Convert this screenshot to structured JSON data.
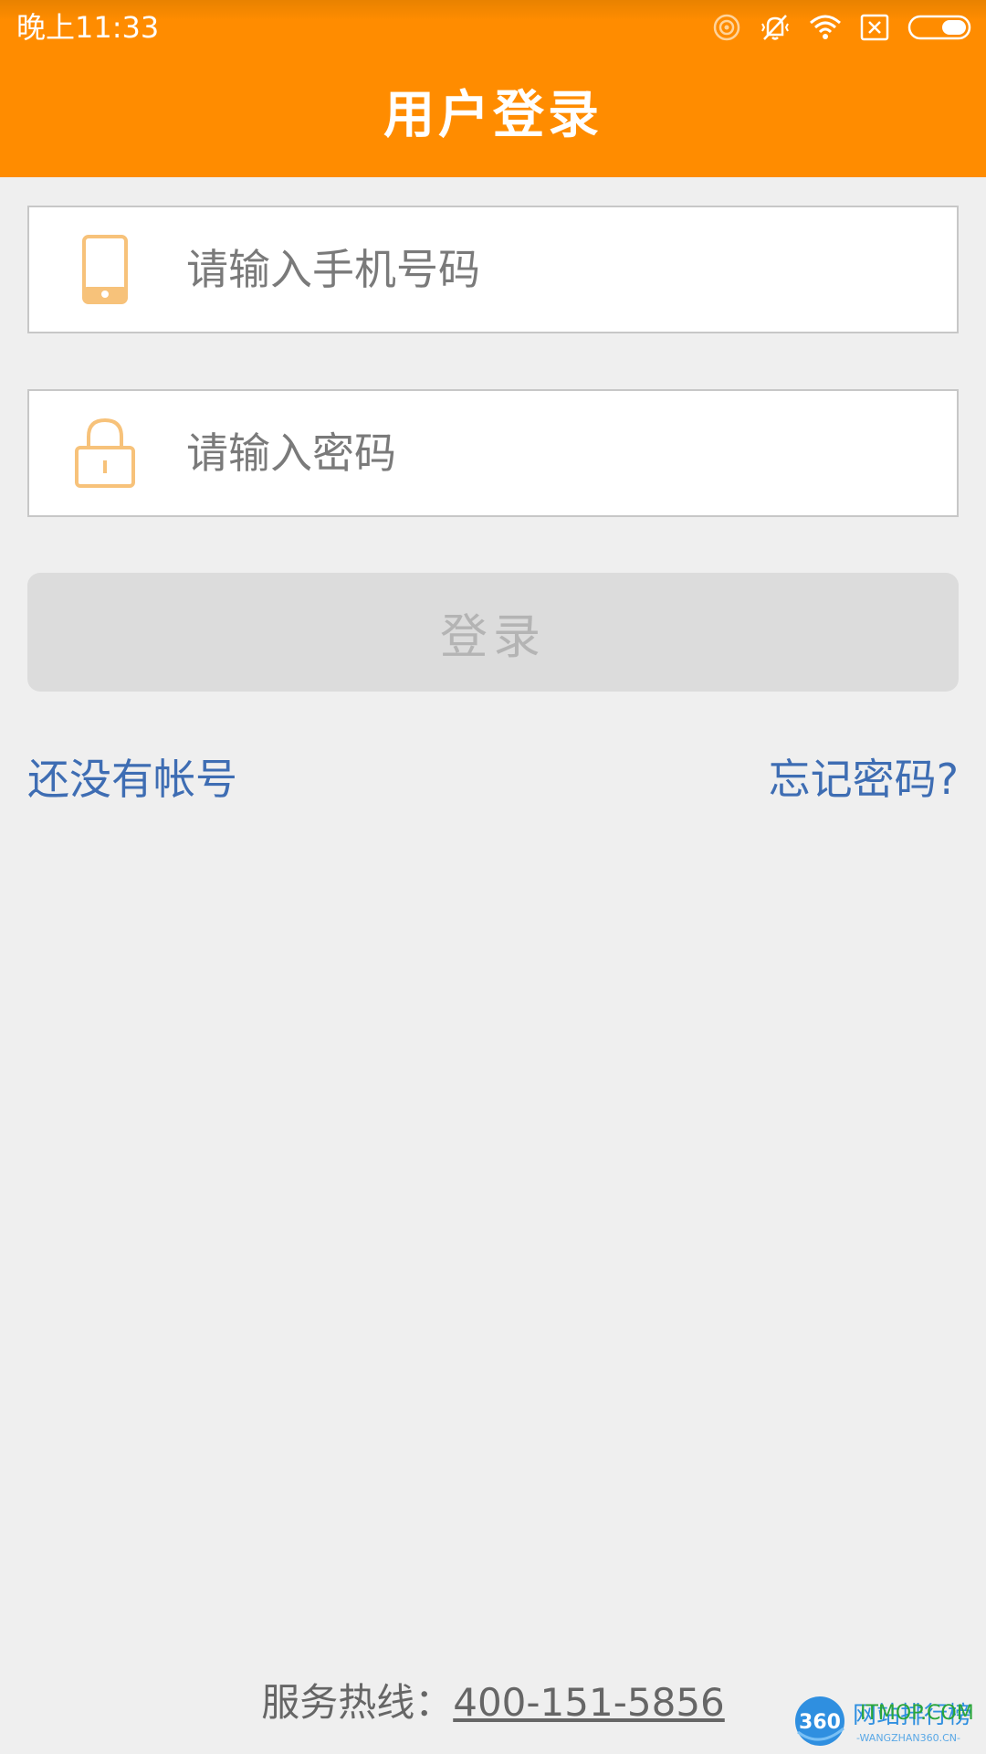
{
  "status_bar": {
    "time": "晚上11:33",
    "icons": [
      "hotspot-icon",
      "vibrate-off-icon",
      "wifi-icon",
      "sim-disabled-icon",
      "battery-icon"
    ]
  },
  "header": {
    "title": "用户登录",
    "background_color": "#ff8c00"
  },
  "form": {
    "phone": {
      "placeholder": "请输入手机号码",
      "value": "",
      "icon": "phone-icon"
    },
    "password": {
      "placeholder": "请输入密码",
      "value": "",
      "icon": "lock-icon"
    },
    "login_label": "登录",
    "icon_color": "#f7c27a"
  },
  "links": {
    "register": "还没有帐号",
    "forgot_password": "忘记密码?",
    "link_color": "#3e6db3"
  },
  "footer": {
    "hotline_label": "服务热线：",
    "hotline_number": "400-151-5856"
  },
  "watermark": {
    "logo_text": "360",
    "site_name": "网站排行榜",
    "overlay": "ITMOP.COM",
    "subtext": "-WANGZHAN360.CN-"
  }
}
